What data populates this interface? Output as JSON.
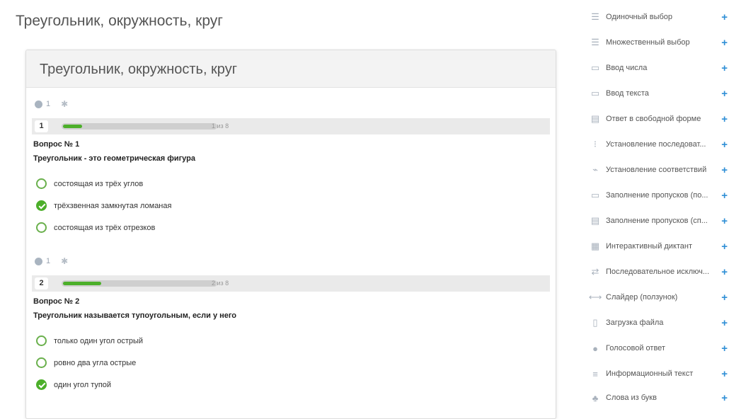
{
  "page": {
    "title": "Треугольник, окружность, круг"
  },
  "card": {
    "title": "Треугольник, окружность, круг"
  },
  "questions": [
    {
      "meta_count": "1",
      "number": "1",
      "progress_text": "1 из 8",
      "progress_fraction": 0.125,
      "title": "Вопрос № 1",
      "text": "Треугольник - это геометрическая фигура",
      "options": [
        {
          "label": "состоящая из трёх углов",
          "checked": false
        },
        {
          "label": "трёхзвенная замкнутая ломаная",
          "checked": true
        },
        {
          "label": "состоящая из трёх отрезков",
          "checked": false
        }
      ]
    },
    {
      "meta_count": "1",
      "number": "2",
      "progress_text": "2 из 8",
      "progress_fraction": 0.25,
      "title": "Вопрос № 2",
      "text": "Треугольник называется тупоугольным, если у него",
      "options": [
        {
          "label": "только один угол острый",
          "checked": false
        },
        {
          "label": "ровно два угла острые",
          "checked": false
        },
        {
          "label": "один угол тупой",
          "checked": true
        }
      ]
    }
  ],
  "sidebar": {
    "items": [
      {
        "icon": "single-choice-icon",
        "glyph": "☰",
        "label": "Одиночный выбор"
      },
      {
        "icon": "multiple-choice-icon",
        "glyph": "☰",
        "label": "Множественный выбор"
      },
      {
        "icon": "number-input-icon",
        "glyph": "▭",
        "label": "Ввод числа"
      },
      {
        "icon": "text-input-icon",
        "glyph": "▭",
        "label": "Ввод текста"
      },
      {
        "icon": "free-form-icon",
        "glyph": "▤",
        "label": "Ответ в свободной форме"
      },
      {
        "icon": "sequence-icon",
        "glyph": "⁝",
        "label": "Установление последоват..."
      },
      {
        "icon": "matching-icon",
        "glyph": "⌁",
        "label": "Установление соответствий"
      },
      {
        "icon": "fill-gaps-icon",
        "glyph": "▭",
        "label": "Заполнение пропусков (по..."
      },
      {
        "icon": "fill-gaps-list-icon",
        "glyph": "▤",
        "label": "Заполнение пропусков (сп..."
      },
      {
        "icon": "dictation-icon",
        "glyph": "▦",
        "label": "Интерактивный диктант"
      },
      {
        "icon": "sequential-exclusion-icon",
        "glyph": "⇄",
        "label": "Последовательное исключ..."
      },
      {
        "icon": "slider-icon",
        "glyph": "⟷",
        "label": "Слайдер (ползунок)"
      },
      {
        "icon": "file-upload-icon",
        "glyph": "▯",
        "label": "Загрузка файла"
      },
      {
        "icon": "microphone-icon",
        "glyph": "●",
        "label": "Голосовой ответ"
      },
      {
        "icon": "info-text-icon",
        "glyph": "≡",
        "label": "Информационный текст"
      },
      {
        "icon": "words-from-letters-icon",
        "glyph": "♣",
        "label": "Слова из букв"
      }
    ],
    "add_symbol": "+"
  },
  "colors": {
    "accent_green": "#4caf2a",
    "plus_blue": "#2f8fd6"
  }
}
